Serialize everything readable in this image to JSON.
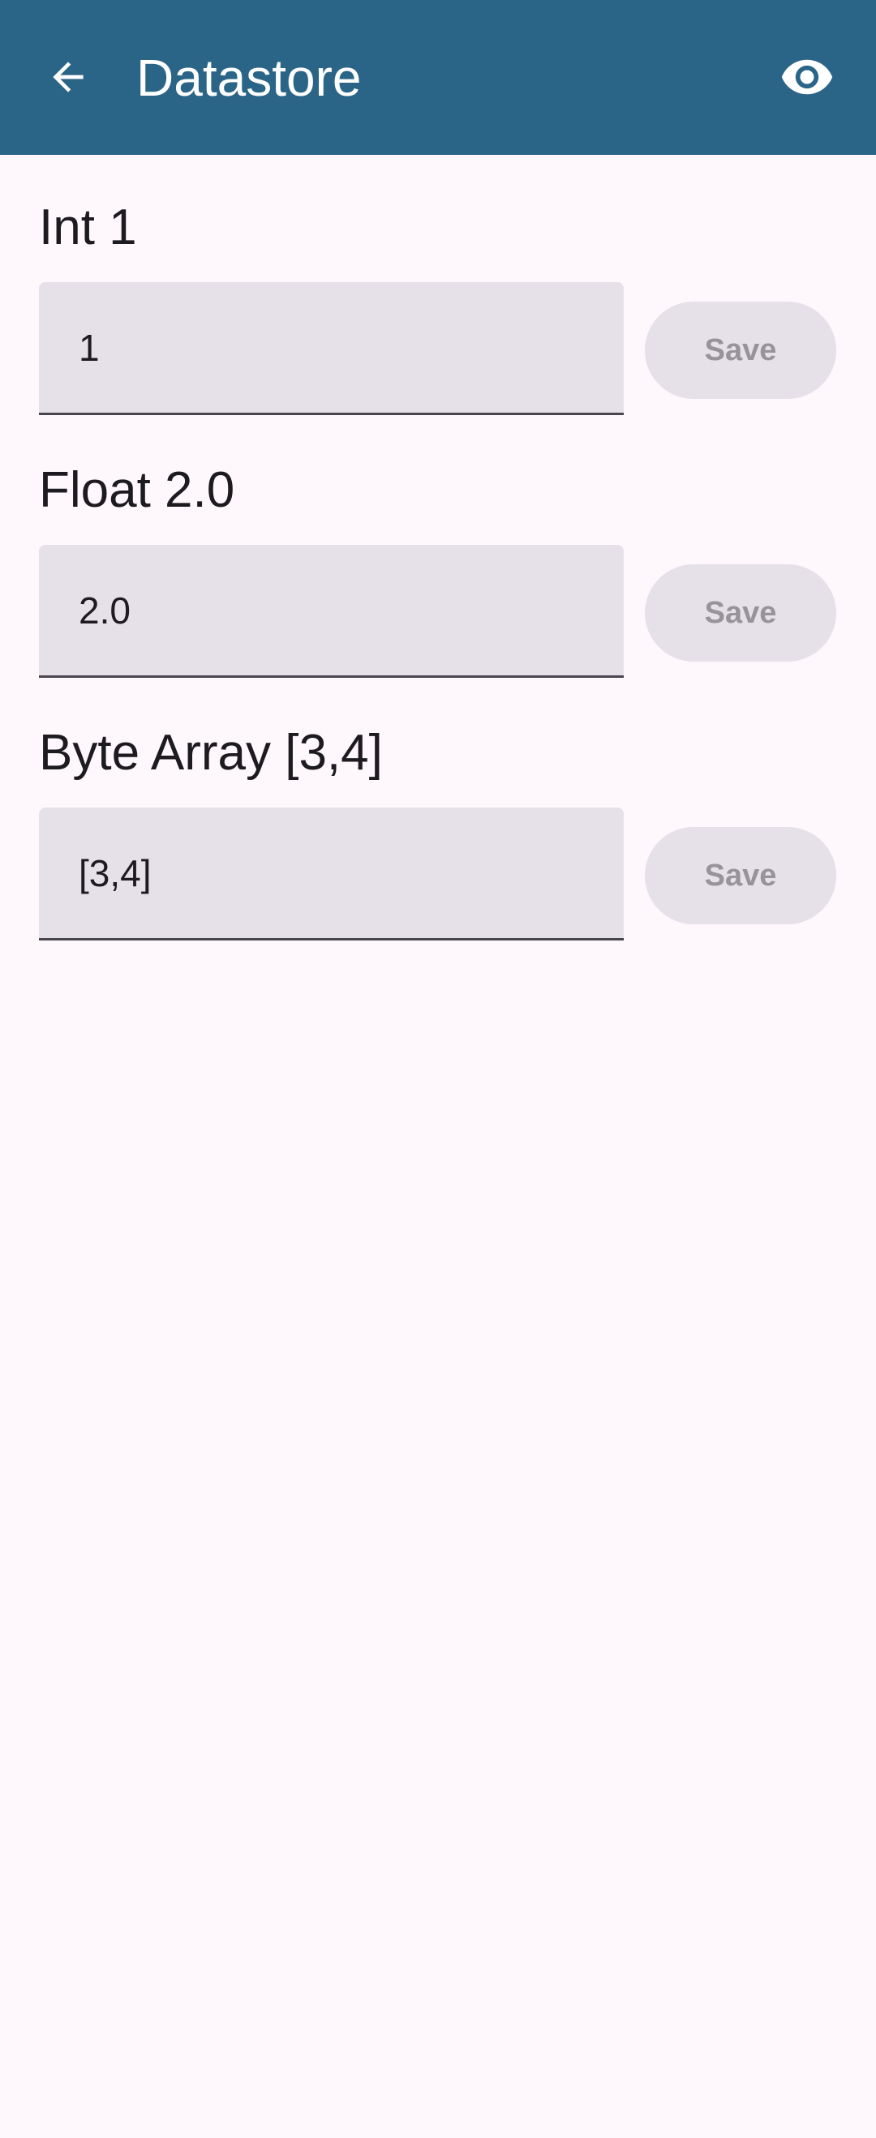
{
  "app_bar": {
    "title": "Datastore",
    "back_icon": "arrow-back-icon",
    "action_icon": "eye-icon",
    "color": "#2a6588"
  },
  "sections": [
    {
      "label": "Int 1",
      "value": "1",
      "save_label": "Save"
    },
    {
      "label": "Float 2.0",
      "value": "2.0",
      "save_label": "Save"
    },
    {
      "label": "Byte Array [3,4]",
      "value": "[3,4]",
      "save_label": "Save"
    }
  ]
}
